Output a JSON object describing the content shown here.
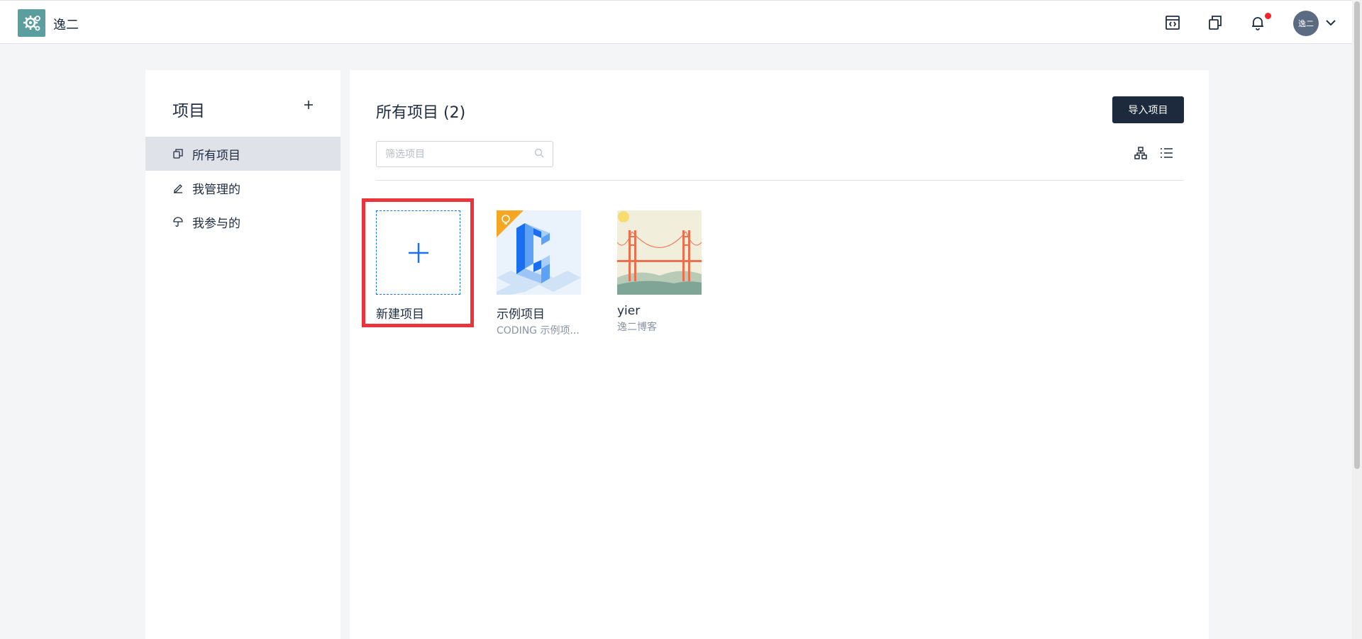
{
  "topbar": {
    "org_name": "逸二",
    "avatar_text": "逸二",
    "icons": [
      "workspace-icon",
      "copy-icon",
      "bell-icon",
      "chevron-down-icon"
    ],
    "notification_dot_color": "#f5222d"
  },
  "sidebar": {
    "title": "项目",
    "items": [
      {
        "label": "所有项目",
        "icon": "copy-icon",
        "active": true
      },
      {
        "label": "我管理的",
        "icon": "pen-icon",
        "active": false
      },
      {
        "label": "我参与的",
        "icon": "umbrella-icon",
        "active": false
      }
    ]
  },
  "main": {
    "title": "所有项目 (2)",
    "import_button": "导入项目",
    "search": {
      "placeholder": "筛选项目",
      "value": ""
    },
    "view_icons": [
      "tree-view-icon",
      "list-view-icon"
    ],
    "cards": [
      {
        "name": "新建项目",
        "desc": "",
        "type": "new"
      },
      {
        "name": "示例项目",
        "desc": "CODING 示例项...",
        "type": "project"
      },
      {
        "name": "yier",
        "desc": "逸二博客",
        "type": "project"
      }
    ]
  },
  "colors": {
    "accent": "#1a6ef0",
    "dark_button": "#1d2a3d",
    "highlight_border": "#e8343a",
    "active_item_bg": "#dfe2e8"
  }
}
